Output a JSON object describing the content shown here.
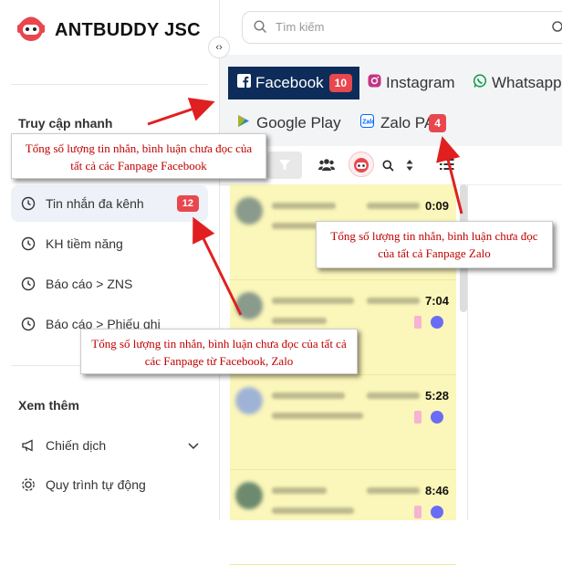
{
  "brand": {
    "name": "ANTBUDDY JSC"
  },
  "search": {
    "placeholder": "Tìm kiếm"
  },
  "sidebar": {
    "quick_access_title": "Truy cập nhanh",
    "more_title": "Xem thêm",
    "items": [
      {
        "label": "Tin nhắn đa kênh",
        "badge": "12",
        "active": true
      },
      {
        "label": "KH tiềm năng"
      },
      {
        "label": "Báo cáo > ZNS"
      },
      {
        "label": "Báo cáo > Phiếu ghi"
      }
    ],
    "more_items": [
      {
        "label": "Chiến dịch"
      },
      {
        "label": "Quy trình tự động"
      }
    ]
  },
  "tabs": [
    {
      "label": "Facebook",
      "badge": "10",
      "active": true
    },
    {
      "label": "Instagram"
    },
    {
      "label": "Whatsapp"
    },
    {
      "label": "Google Play"
    },
    {
      "label": "Zalo PA",
      "badge": "4"
    }
  ],
  "conversations": [
    {
      "time": "0:09"
    },
    {
      "time": "7:04"
    },
    {
      "time": "5:28"
    },
    {
      "time": "8:46"
    }
  ],
  "annotations": {
    "facebook": "Tổng số lượng tin nhắn, bình luận chưa đọc của tất cả các Fanpage Facebook",
    "zalo": "Tổng số lượng tin nhắn, bình luận chưa đọc của tất cả Fanpage Zalo",
    "multichannel": "Tổng số lượng tin nhắn, bình luận chưa đọc của tất cả các Fanpage từ Facebook, Zalo"
  },
  "colors": {
    "accent_navy": "#0d2c5a",
    "badge_red": "#e8474e",
    "annotation_red": "#c00000",
    "arrow_red": "#e02020",
    "list_highlight": "#fbf6b9"
  }
}
